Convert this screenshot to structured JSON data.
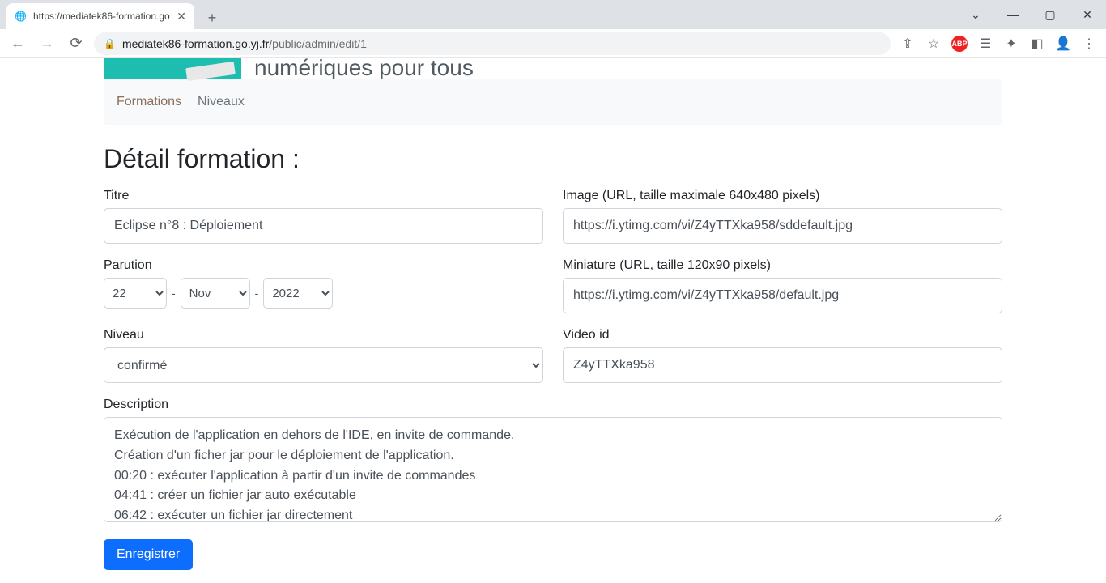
{
  "browser": {
    "tab_title": "https://mediatek86-formation.go",
    "url_domain": "mediatek86-formation.go.yj.fr",
    "url_path": "/public/admin/edit/1"
  },
  "banner": {
    "subtitle": "numériques pour tous"
  },
  "nav": {
    "formations": "Formations",
    "niveaux": "Niveaux"
  },
  "heading": "Détail formation :",
  "labels": {
    "titre": "Titre",
    "image": "Image (URL, taille maximale 640x480 pixels)",
    "parution": "Parution",
    "miniature": "Miniature (URL, taille 120x90 pixels)",
    "niveau": "Niveau",
    "video": "Video id",
    "description": "Description"
  },
  "values": {
    "titre": "Eclipse n°8 : Déploiement",
    "image": "https://i.ytimg.com/vi/Z4yTTXka958/sddefault.jpg",
    "miniature": "https://i.ytimg.com/vi/Z4yTTXka958/default.jpg",
    "day": "22",
    "month": "Nov",
    "year": "2022",
    "niveau": "confirmé",
    "video": "Z4yTTXka958",
    "description": "Exécution de l'application en dehors de l'IDE, en invite de commande.\nCréation d'un ficher jar pour le déploiement de l'application.\n00:20 : exécuter l'application à partir d'un invite de commandes\n04:41 : créer un fichier jar auto exécutable\n06:42 : exécuter un fichier jar directement"
  },
  "button": {
    "save": "Enregistrer"
  }
}
